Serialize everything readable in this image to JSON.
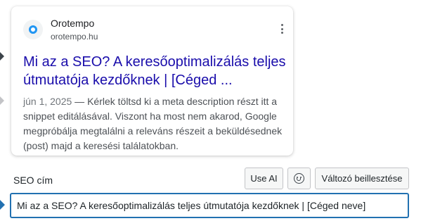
{
  "snippet": {
    "site_name": "Orotempo",
    "site_url": "orotempo.hu",
    "title": "Mi az a SEO? A keresőoptimalizálás teljes útmutatója kezdőknek | [Céged ...",
    "date": "jún 1, 2025",
    "separator": " — ",
    "description": "Kérlek töltsd ki a meta description részt itt a snippet editálásával. Viszont ha most nem akarod, Google megpróbálja megtalálni a releváns részeit a beküldésednek (post) majd a keresési találatokban.",
    "favicon_icon": "orotempo-favicon-icon",
    "menu_icon": "more-vertical-icon"
  },
  "seo_title": {
    "label": "SEO cím",
    "use_ai_label": "Use AI",
    "emoji_icon": "smiley-icon",
    "insert_variable_label": "Változó beillesztése",
    "value": "Mi az a SEO? A keresőoptimalizálás teljes útmutatója kezdőknek | [Céged neve]"
  },
  "colors": {
    "title_link": "#1a0dab",
    "focus_accent": "#2271b1",
    "favicon": "#2196f3"
  }
}
